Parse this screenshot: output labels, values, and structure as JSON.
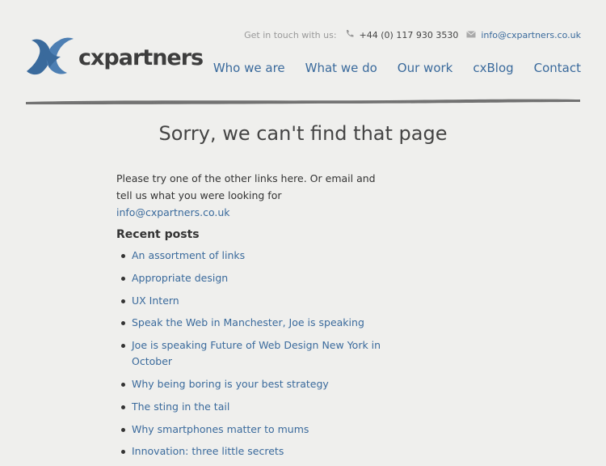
{
  "brand": {
    "name": "cxpartners",
    "logo_colors": [
      "#3a6a9c",
      "#5d8bbd"
    ]
  },
  "contact": {
    "label": "Get in touch with us:",
    "phone": "+44 (0) 117 930 3530",
    "email": "info@cxpartners.co.uk",
    "phone_icon": "phone-icon",
    "email_icon": "envelope-icon"
  },
  "nav": {
    "items": [
      {
        "label": "Who we are"
      },
      {
        "label": "What we do"
      },
      {
        "label": "Our work"
      },
      {
        "label": "cxBlog"
      },
      {
        "label": "Contact"
      }
    ]
  },
  "page": {
    "title": "Sorry, we can't find that page",
    "intro_text": "Please try one of the other links here. Or email and tell us what you were looking for",
    "intro_email": "info@cxpartners.co.uk"
  },
  "recent": {
    "heading": "Recent posts",
    "posts": [
      {
        "label": "An assortment of links"
      },
      {
        "label": "Appropriate design"
      },
      {
        "label": "UX Intern"
      },
      {
        "label": "Speak the Web in Manchester, Joe is speaking"
      },
      {
        "label": "Joe is speaking Future of Web Design New York in October"
      },
      {
        "label": "Why being boring is your best strategy"
      },
      {
        "label": "The sting in the tail"
      },
      {
        "label": "Why smartphones matter to mums"
      },
      {
        "label": "Innovation: three little secrets"
      }
    ]
  },
  "colors": {
    "link": "#3a6a9c",
    "background": "#efefed",
    "text": "#333333"
  }
}
